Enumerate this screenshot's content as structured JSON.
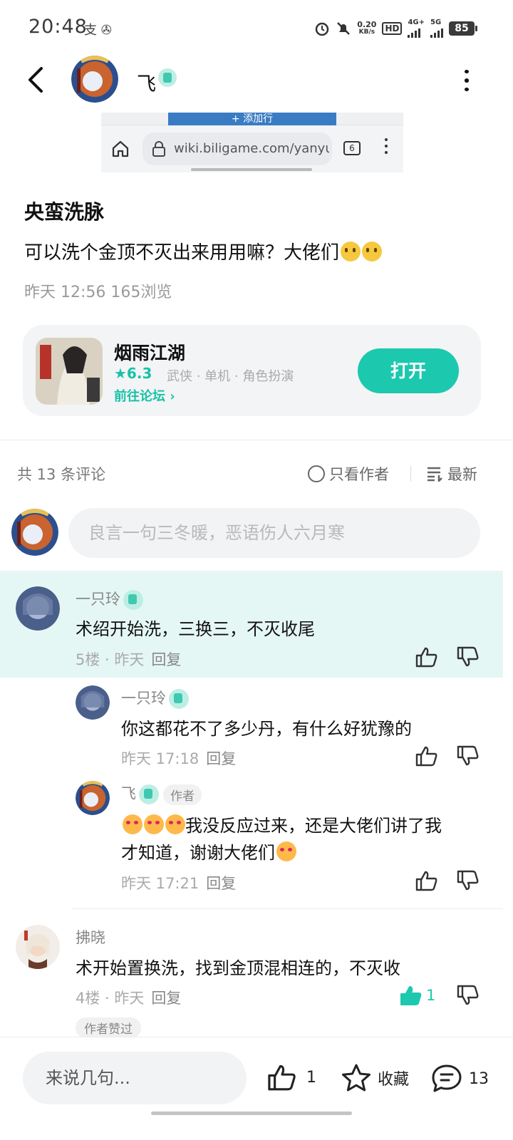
{
  "status_bar": {
    "time": "20:48",
    "app_icons": "支 ✇",
    "net_speed_top": "0.20",
    "net_speed_bottom": "KB/s",
    "hd_tag": "HD",
    "net_4g": "4G+",
    "net_5g": "5G",
    "battery": "85"
  },
  "header": {
    "username": "飞"
  },
  "embed": {
    "add_row": "+ 添加行",
    "url": "wiki.biligame.com/yanyu/%",
    "tab_count": "6"
  },
  "post": {
    "title": "央蛮洗脉",
    "body": "可以洗个金顶不灭出来用用嘛？大佬们",
    "meta": "昨天 12:56  165浏览"
  },
  "game": {
    "name": "烟雨江湖",
    "rating": "★6.3",
    "tags": "武侠 · 单机 · 角色扮演",
    "forum": "前往论坛 ›",
    "open_label": "打开"
  },
  "comments_header": {
    "count": "共 13 条评论",
    "only_author": "只看作者",
    "sort": "最新"
  },
  "reply_input": {
    "placeholder": "良言一句三冬暖，恶语伤人六月寒"
  },
  "comments": [
    {
      "name": "一只玲",
      "text": "术绍开始洗，三换三，不灭收尾",
      "meta": "5楼 · 昨天",
      "reply": "回复"
    },
    {
      "name": "一只玲",
      "text": "你这都花不了多少丹，有什么好犹豫的",
      "meta": "昨天 17:18",
      "reply": "回复"
    },
    {
      "name": "飞",
      "author_tag": "作者",
      "text_line1": "我没反应过来，还是大佬们讲了我",
      "text_line2": "才知道，谢谢大佬们",
      "meta": "昨天 17:21",
      "reply": "回复"
    },
    {
      "name": "拂晓",
      "text": "术开始置换洗，找到金顶混相连的，不灭收",
      "meta": "4楼 · 昨天",
      "reply": "回复",
      "likes": "1",
      "liked_tag": "作者赞过"
    }
  ],
  "bottom_bar": {
    "say_placeholder": "来说几句...",
    "like_count": "1",
    "favorite_label": "收藏",
    "comment_count": "13"
  },
  "colors": {
    "accent": "#1cc9ae",
    "highlight_bg": "#e5f7f4"
  }
}
